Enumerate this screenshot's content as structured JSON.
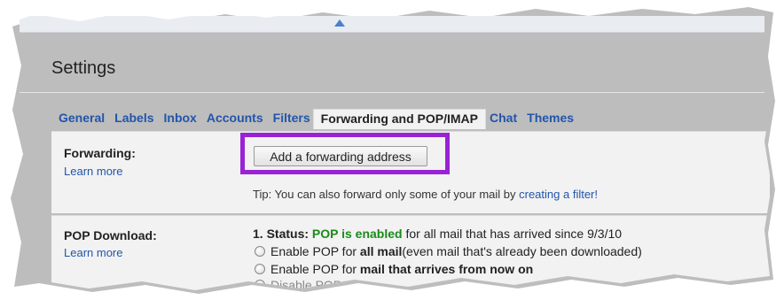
{
  "page": {
    "title": "Settings"
  },
  "tabs": [
    {
      "label": "General"
    },
    {
      "label": "Labels"
    },
    {
      "label": "Inbox"
    },
    {
      "label": "Accounts"
    },
    {
      "label": "Filters"
    },
    {
      "label": "Forwarding and POP/IMAP",
      "active": true
    },
    {
      "label": "Chat"
    },
    {
      "label": "Themes"
    }
  ],
  "forwarding": {
    "label": "Forwarding:",
    "learn_more": "Learn more",
    "add_button": "Add a forwarding address",
    "tip_prefix": "Tip: You can also forward only some of your mail by ",
    "tip_link": "creating a filter!",
    "highlight_color": "#9a22d6"
  },
  "pop": {
    "label": "POP Download:",
    "learn_more": "Learn more",
    "status_num": "1. Status:",
    "status_value": "POP is enabled",
    "status_rest": " for all mail that has arrived since 9/3/10",
    "option1_prefix": "Enable POP for ",
    "option1_bold": "all mail",
    "option1_rest": " (even mail that's already been downloaded)",
    "option2_prefix": "Enable POP for ",
    "option2_bold": "mail that arrives from now on",
    "option3_partial": "Disable POP",
    "status_color": "#1a8a1a"
  },
  "colors": {
    "link": "#2255aa",
    "section_bg": "#f2f2f2"
  }
}
